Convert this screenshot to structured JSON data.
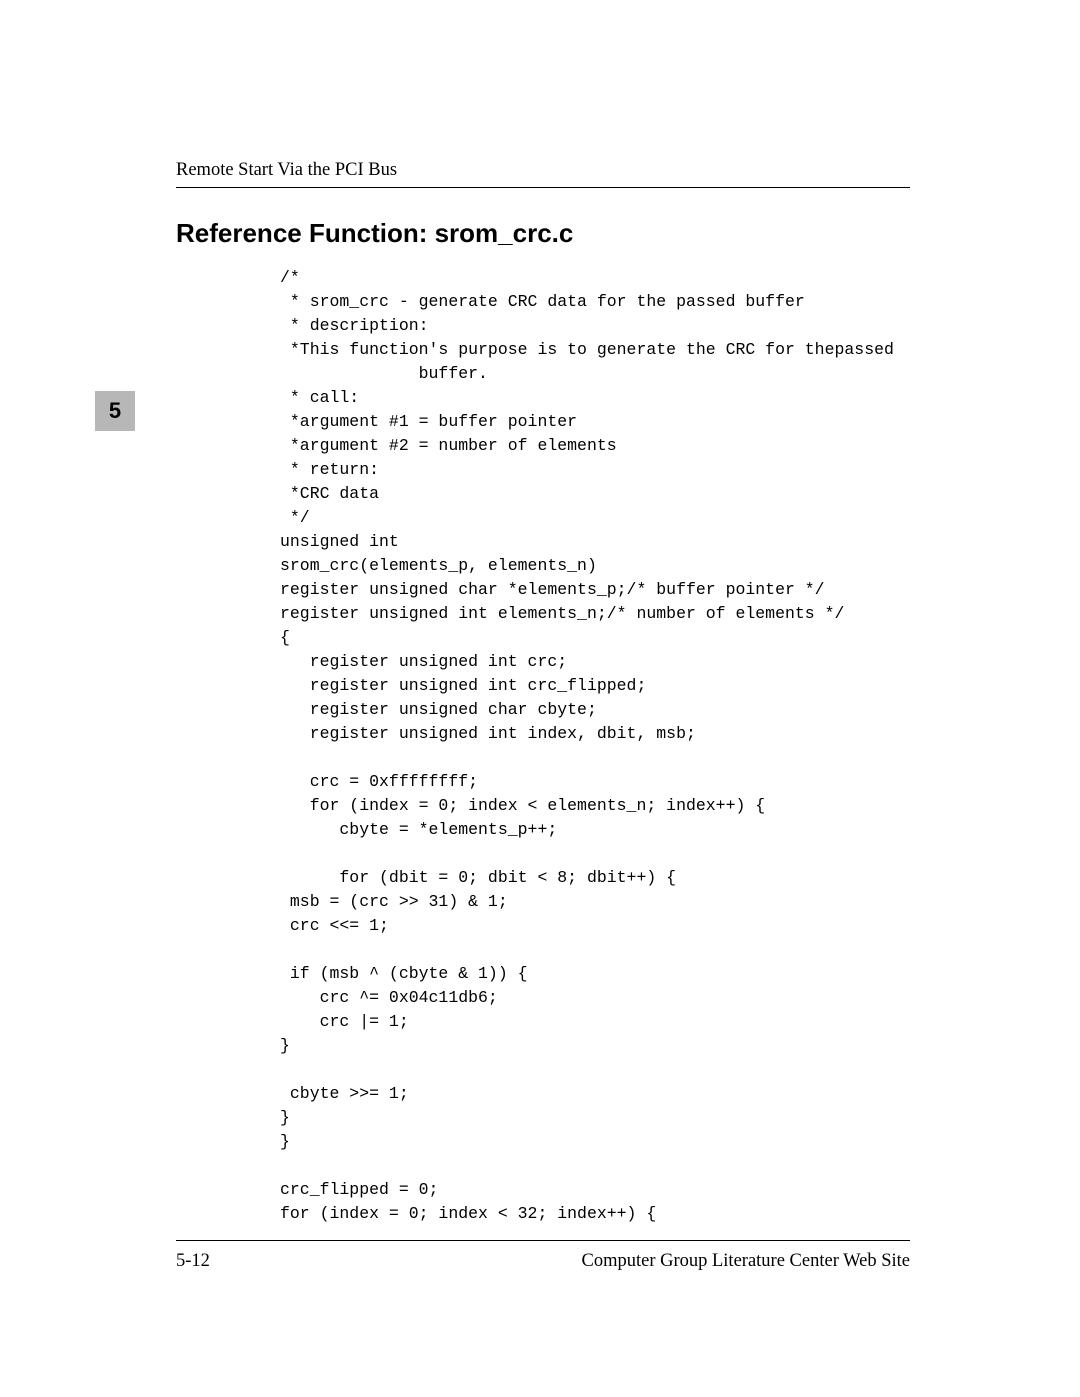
{
  "header": {
    "running": "Remote Start Via the PCI Bus"
  },
  "chapter": {
    "number": "5"
  },
  "section": {
    "title": "Reference Function: srom_crc.c"
  },
  "code": {
    "lines": [
      "/*",
      " * srom_crc - generate CRC data for the passed buffer",
      " * description:",
      " *This function's purpose is to generate the CRC for thepassed",
      "              buffer.",
      " * call:",
      " *argument #1 = buffer pointer",
      " *argument #2 = number of elements",
      " * return:",
      " *CRC data",
      " */",
      "unsigned int",
      "srom_crc(elements_p, elements_n)",
      "register unsigned char *elements_p;/* buffer pointer */",
      "register unsigned int elements_n;/* number of elements */",
      "{",
      "   register unsigned int crc;",
      "   register unsigned int crc_flipped;",
      "   register unsigned char cbyte;",
      "   register unsigned int index, dbit, msb;",
      "",
      "   crc = 0xffffffff;",
      "   for (index = 0; index < elements_n; index++) {",
      "      cbyte = *elements_p++;",
      "",
      "      for (dbit = 0; dbit < 8; dbit++) {",
      " msb = (crc >> 31) & 1;",
      " crc <<= 1;",
      "",
      " if (msb ^ (cbyte & 1)) {",
      "    crc ^= 0x04c11db6;",
      "    crc |= 1;",
      "}",
      "",
      " cbyte >>= 1;",
      "}",
      "}",
      "",
      "crc_flipped = 0;",
      "for (index = 0; index < 32; index++) {"
    ]
  },
  "footer": {
    "page_number": "5-12",
    "site": "Computer Group Literature Center Web Site"
  }
}
